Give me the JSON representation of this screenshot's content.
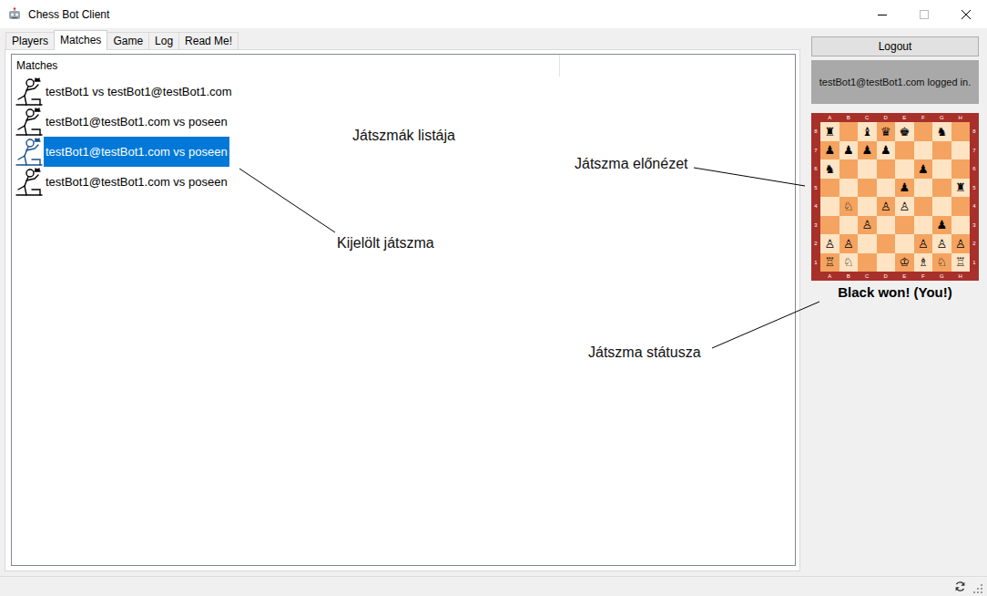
{
  "window": {
    "title": "Chess Bot Client"
  },
  "tabs": [
    {
      "label": "Players",
      "selected": false
    },
    {
      "label": "Matches",
      "selected": true
    },
    {
      "label": "Game",
      "selected": false
    },
    {
      "label": "Log",
      "selected": false
    },
    {
      "label": "Read Me!",
      "selected": false
    }
  ],
  "matches": {
    "header": "Matches",
    "rows": [
      {
        "label": "testBot1 vs testBot1@testBot1.com",
        "selected": false
      },
      {
        "label": "testBot1@testBot1.com vs poseen",
        "selected": false
      },
      {
        "label": "testBot1@testBot1.com vs poseen",
        "selected": true
      },
      {
        "label": "testBot1@testBot1.com vs poseen",
        "selected": false
      }
    ]
  },
  "sidebar": {
    "logout": "Logout",
    "login_status": "testBot1@testBot1.com logged in.",
    "board": {
      "files": [
        "A",
        "B",
        "C",
        "D",
        "E",
        "F",
        "G",
        "H"
      ],
      "ranks": [
        "8",
        "7",
        "6",
        "5",
        "4",
        "3",
        "2",
        "1"
      ],
      "squares": [
        [
          "♜",
          "",
          "♝",
          "♛",
          "♚",
          "",
          "♞",
          ""
        ],
        [
          "♟",
          "♟",
          "♟",
          "♟",
          "",
          "",
          "",
          ""
        ],
        [
          "♞",
          "",
          "",
          "",
          "",
          "♟",
          "",
          ""
        ],
        [
          "",
          "",
          "",
          "",
          "♟",
          "",
          "",
          "♜"
        ],
        [
          "",
          "♘",
          "",
          "♙",
          "♙",
          "",
          "",
          ""
        ],
        [
          "",
          "",
          "♙",
          "",
          "",
          "",
          "♟",
          ""
        ],
        [
          "♙",
          "♙",
          "",
          "",
          "",
          "♙",
          "♙",
          "♙"
        ],
        [
          "♖",
          "♘",
          "",
          "",
          "♔",
          "♗",
          "♘",
          "♖"
        ]
      ]
    },
    "game_status": "Black won! (You!)"
  },
  "annotations": [
    "Játszmák listája",
    "Kijelölt játszma",
    "Játszma előnézet",
    "Játszma státusza"
  ]
}
